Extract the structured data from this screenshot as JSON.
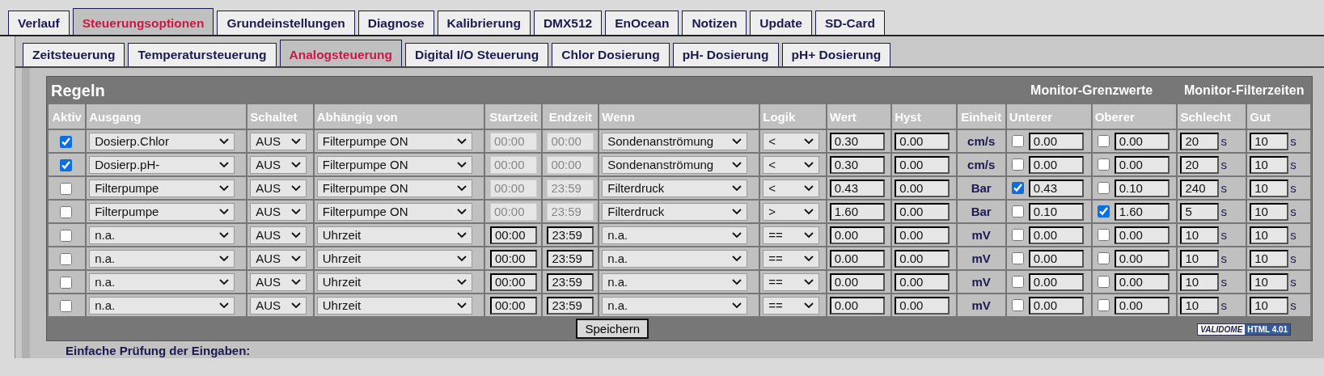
{
  "main_tabs": [
    {
      "label": "Verlauf",
      "selected": false
    },
    {
      "label": "Steuerungsoptionen",
      "selected": true
    },
    {
      "label": "Grundeinstellungen",
      "selected": false
    },
    {
      "label": "Diagnose",
      "selected": false
    },
    {
      "label": "Kalibrierung",
      "selected": false
    },
    {
      "label": "DMX512",
      "selected": false
    },
    {
      "label": "EnOcean",
      "selected": false
    },
    {
      "label": "Notizen",
      "selected": false
    },
    {
      "label": "Update",
      "selected": false
    },
    {
      "label": "SD-Card",
      "selected": false
    }
  ],
  "sub_tabs": [
    {
      "label": "Zeitsteuerung",
      "selected": false
    },
    {
      "label": "Temperatursteuerung",
      "selected": false
    },
    {
      "label": "Analogsteuerung",
      "selected": true
    },
    {
      "label": "Digital I/O Steuerung",
      "selected": false
    },
    {
      "label": "Chlor Dosierung",
      "selected": false
    },
    {
      "label": "pH- Dosierung",
      "selected": false
    },
    {
      "label": "pH+ Dosierung",
      "selected": false
    }
  ],
  "table": {
    "title": "Regeln",
    "group_headers": [
      "Monitor-Grenzwerte",
      "Monitor-Filterzeiten"
    ],
    "columns": [
      "Aktiv",
      "Ausgang",
      "Schaltet",
      "Abhängig von",
      "Startzeit",
      "Endzeit",
      "Wenn",
      "Logik",
      "Wert",
      "Hyst",
      "Einheit",
      "Unterer",
      "Oberer",
      "Schlecht",
      "Gut"
    ],
    "rows": [
      {
        "active": true,
        "output": "Dosierp.Chlor",
        "switches": "AUS",
        "depends": "Filterpumpe ON",
        "start": "00:00",
        "end": "00:00",
        "times_disabled": true,
        "condition": "Sondenanströmung",
        "logic": "<",
        "value": "0.30",
        "hyst": "0.00",
        "unit": "cm/s",
        "lower_on": false,
        "lower": "0.00",
        "upper_on": false,
        "upper": "0.00",
        "bad": "20",
        "bad_unit": "s",
        "good": "10",
        "good_unit": "s"
      },
      {
        "active": true,
        "output": "Dosierp.pH-",
        "switches": "AUS",
        "depends": "Filterpumpe ON",
        "start": "00:00",
        "end": "00:00",
        "times_disabled": true,
        "condition": "Sondenanströmung",
        "logic": "<",
        "value": "0.30",
        "hyst": "0.00",
        "unit": "cm/s",
        "lower_on": false,
        "lower": "0.00",
        "upper_on": false,
        "upper": "0.00",
        "bad": "20",
        "bad_unit": "s",
        "good": "10",
        "good_unit": "s"
      },
      {
        "active": false,
        "output": "Filterpumpe",
        "switches": "AUS",
        "depends": "Filterpumpe ON",
        "start": "00:00",
        "end": "23:59",
        "times_disabled": true,
        "condition": "Filterdruck",
        "logic": "<",
        "value": "0.43",
        "hyst": "0.00",
        "unit": "Bar",
        "lower_on": true,
        "lower": "0.43",
        "upper_on": false,
        "upper": "0.10",
        "bad": "240",
        "bad_unit": "s",
        "good": "10",
        "good_unit": "s"
      },
      {
        "active": false,
        "output": "Filterpumpe",
        "switches": "AUS",
        "depends": "Filterpumpe ON",
        "start": "00:00",
        "end": "23:59",
        "times_disabled": true,
        "condition": "Filterdruck",
        "logic": ">",
        "value": "1.60",
        "hyst": "0.00",
        "unit": "Bar",
        "lower_on": false,
        "lower": "0.10",
        "upper_on": true,
        "upper": "1.60",
        "bad": "5",
        "bad_unit": "s",
        "good": "10",
        "good_unit": "s"
      },
      {
        "active": false,
        "output": "n.a.",
        "switches": "AUS",
        "depends": "Uhrzeit",
        "start": "00:00",
        "end": "23:59",
        "times_disabled": false,
        "condition": "n.a.",
        "logic": "==",
        "value": "0.00",
        "hyst": "0.00",
        "unit": "mV",
        "lower_on": false,
        "lower": "0.00",
        "upper_on": false,
        "upper": "0.00",
        "bad": "10",
        "bad_unit": "s",
        "good": "10",
        "good_unit": "s"
      },
      {
        "active": false,
        "output": "n.a.",
        "switches": "AUS",
        "depends": "Uhrzeit",
        "start": "00:00",
        "end": "23:59",
        "times_disabled": false,
        "condition": "n.a.",
        "logic": "==",
        "value": "0.00",
        "hyst": "0.00",
        "unit": "mV",
        "lower_on": false,
        "lower": "0.00",
        "upper_on": false,
        "upper": "0.00",
        "bad": "10",
        "bad_unit": "s",
        "good": "10",
        "good_unit": "s"
      },
      {
        "active": false,
        "output": "n.a.",
        "switches": "AUS",
        "depends": "Uhrzeit",
        "start": "00:00",
        "end": "23:59",
        "times_disabled": false,
        "condition": "n.a.",
        "logic": "==",
        "value": "0.00",
        "hyst": "0.00",
        "unit": "mV",
        "lower_on": false,
        "lower": "0.00",
        "upper_on": false,
        "upper": "0.00",
        "bad": "10",
        "bad_unit": "s",
        "good": "10",
        "good_unit": "s"
      },
      {
        "active": false,
        "output": "n.a.",
        "switches": "AUS",
        "depends": "Uhrzeit",
        "start": "00:00",
        "end": "23:59",
        "times_disabled": false,
        "condition": "n.a.",
        "logic": "==",
        "value": "0.00",
        "hyst": "0.00",
        "unit": "mV",
        "lower_on": false,
        "lower": "0.00",
        "upper_on": false,
        "upper": "0.00",
        "bad": "10",
        "bad_unit": "s",
        "good": "10",
        "good_unit": "s"
      }
    ],
    "save_button": "Speichern",
    "badge": {
      "brand": "VALIDOME",
      "version": "HTML 4.01"
    }
  },
  "footer_text": "Einfache Prüfung der Eingaben:"
}
